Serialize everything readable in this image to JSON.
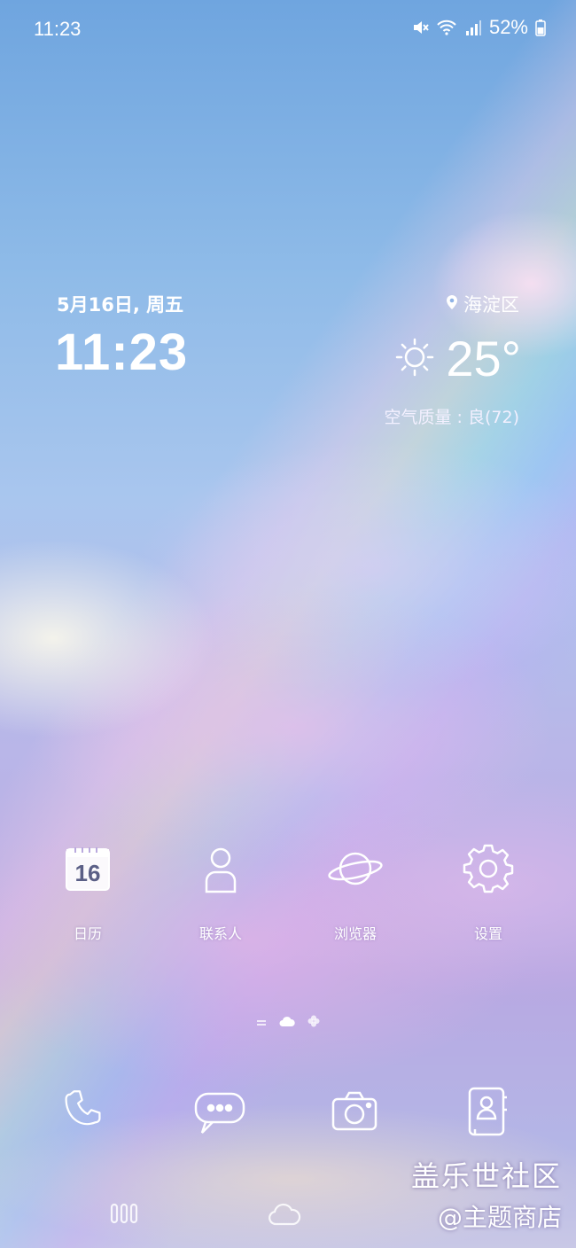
{
  "status_bar": {
    "time": "11:23",
    "battery_percent": "52%",
    "icons": [
      "mute-icon",
      "wifi-icon",
      "signal-icon",
      "battery-icon"
    ]
  },
  "clock_widget": {
    "date": "5月16日, 周五",
    "time": "11:23",
    "location": "海淀区",
    "weather_icon": "sun-icon",
    "temperature": "25°",
    "air_quality": "空气质量 : 良(72)"
  },
  "apps": [
    {
      "label": "日历",
      "icon": "calendar-icon",
      "icon_text": "16"
    },
    {
      "label": "联系人",
      "icon": "contacts-person-icon"
    },
    {
      "label": "浏览器",
      "icon": "planet-browser-icon"
    },
    {
      "label": "设置",
      "icon": "gear-icon"
    }
  ],
  "page_indicator": {
    "pages": [
      "menu-page",
      "cloud-page",
      "clover-page"
    ],
    "active": 1
  },
  "dock": [
    {
      "icon": "phone-icon"
    },
    {
      "icon": "message-bubble-icon"
    },
    {
      "icon": "camera-icon"
    },
    {
      "icon": "contact-book-icon"
    }
  ],
  "nav_bar": [
    "recent-apps-button",
    "home-button"
  ],
  "watermark": {
    "line1": "盖乐世社区",
    "line2": "@主题商店"
  },
  "colors": {
    "icon_stroke": "#ffffff",
    "sky_top": "#6fa5df",
    "cloud_pink": "#e1b4e6"
  }
}
